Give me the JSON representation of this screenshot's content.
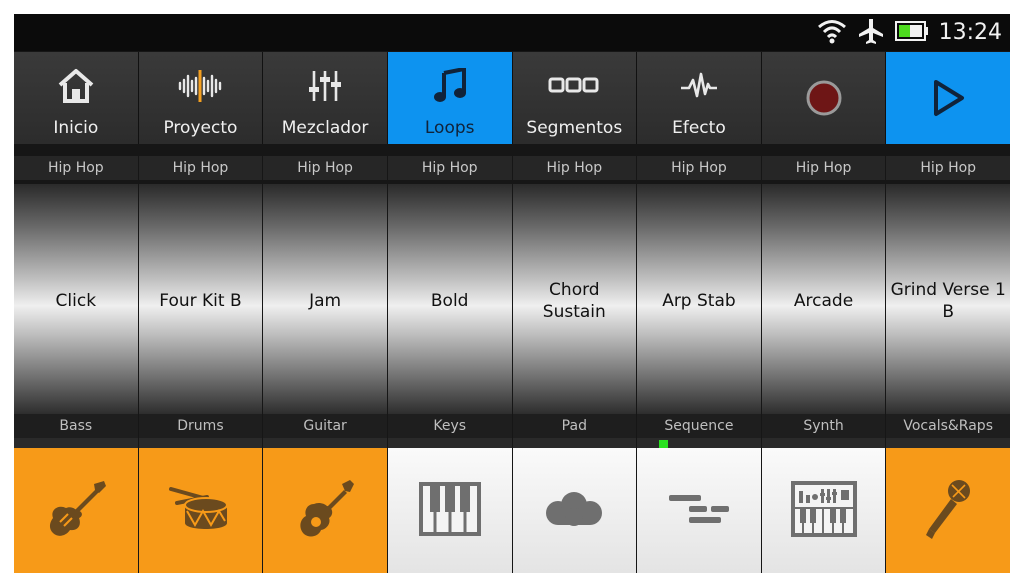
{
  "status": {
    "time": "13:24",
    "icons": [
      "wifi-icon",
      "airplane-icon",
      "battery-icon"
    ]
  },
  "toolbar": [
    {
      "label": "Inicio",
      "icon": "home-icon"
    },
    {
      "label": "Proyecto",
      "icon": "waveform-icon"
    },
    {
      "label": "Mezclador",
      "icon": "mixer-sliders-icon"
    },
    {
      "label": "Loops",
      "icon": "music-note-icon",
      "active": true
    },
    {
      "label": "Segmentos",
      "icon": "segments-icon"
    },
    {
      "label": "Efecto",
      "icon": "pulse-icon"
    },
    {
      "label": "",
      "icon": "record-icon"
    },
    {
      "label": "",
      "icon": "play-icon",
      "active": true
    }
  ],
  "loops": [
    {
      "category": "Hip Hop",
      "name": "Click"
    },
    {
      "category": "Hip Hop",
      "name": "Four Kit B"
    },
    {
      "category": "Hip Hop",
      "name": "Jam"
    },
    {
      "category": "Hip Hop",
      "name": "Bold"
    },
    {
      "category": "Hip Hop",
      "name": "Chord Sustain"
    },
    {
      "category": "Hip Hop",
      "name": "Arp Stab"
    },
    {
      "category": "Hip Hop",
      "name": "Arcade"
    },
    {
      "category": "Hip Hop",
      "name": "Grind Verse 1 B"
    }
  ],
  "instruments": [
    {
      "name": "Bass",
      "icon": "electric-guitar-icon",
      "active": true
    },
    {
      "name": "Drums",
      "icon": "drum-icon",
      "active": true
    },
    {
      "name": "Guitar",
      "icon": "acoustic-guitar-icon",
      "active": true
    },
    {
      "name": "Keys",
      "icon": "piano-keys-icon",
      "active": false
    },
    {
      "name": "Pad",
      "icon": "cloud-icon",
      "active": false
    },
    {
      "name": "Sequence",
      "icon": "sequence-bars-icon",
      "active": false,
      "playing": true
    },
    {
      "name": "Synth",
      "icon": "synth-icon",
      "active": false
    },
    {
      "name": "Vocals&Raps",
      "icon": "microphone-icon",
      "active": true
    }
  ],
  "colors": {
    "accent_blue": "#0d93f0",
    "instrument_orange": "#f79a18",
    "playing_indicator": "#29e020"
  }
}
